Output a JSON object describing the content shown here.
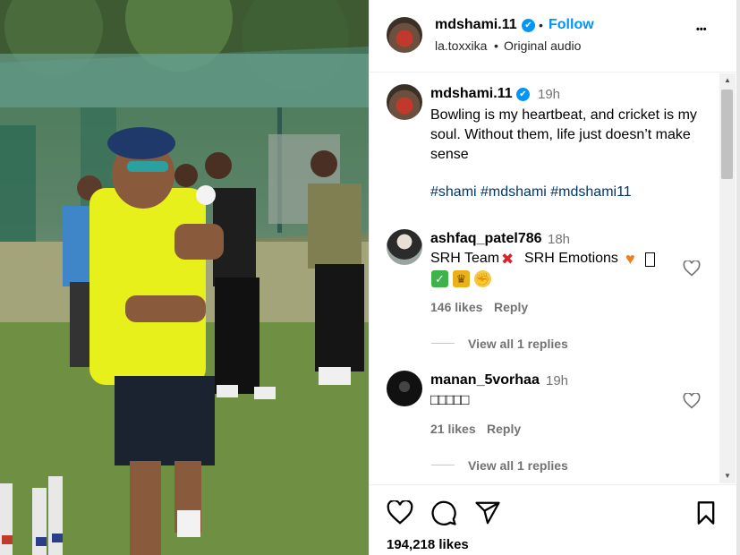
{
  "post_header": {
    "username": "mdshami.11",
    "follow_label": "Follow",
    "separator": "•",
    "audio_artist": "la.toxxika",
    "audio_bullet": "•",
    "audio_label": "Original audio",
    "more_label": "•••"
  },
  "caption": {
    "username": "mdshami.11",
    "time": "19h",
    "text": "Bowling is my heartbeat, and cricket is my soul. Without them, life just doesn’t make sense",
    "hashtags": "#shami #mdshami #mdshami11"
  },
  "comments": [
    {
      "username": "ashfaq_patel786",
      "time": "18h",
      "text_part1": "SRH Team",
      "text_part2": "SRH Emotions",
      "likes": "146 likes",
      "reply_label": "Reply",
      "view_replies": "View all 1 replies"
    },
    {
      "username": "manan_5vorhaa",
      "time": "19h",
      "text": "□□□□□",
      "likes": "21 likes",
      "reply_label": "Reply",
      "view_replies": "View all 1 replies"
    }
  ],
  "actions": {
    "like_count": "194,218 likes"
  },
  "icons": {
    "like": "heart-icon",
    "comment": "comment-icon",
    "share": "share-icon",
    "save": "bookmark-icon",
    "comment_like": "heart-icon"
  },
  "colors": {
    "accent": "#0095f6",
    "hashtag": "#00376b",
    "muted": "#737373"
  }
}
